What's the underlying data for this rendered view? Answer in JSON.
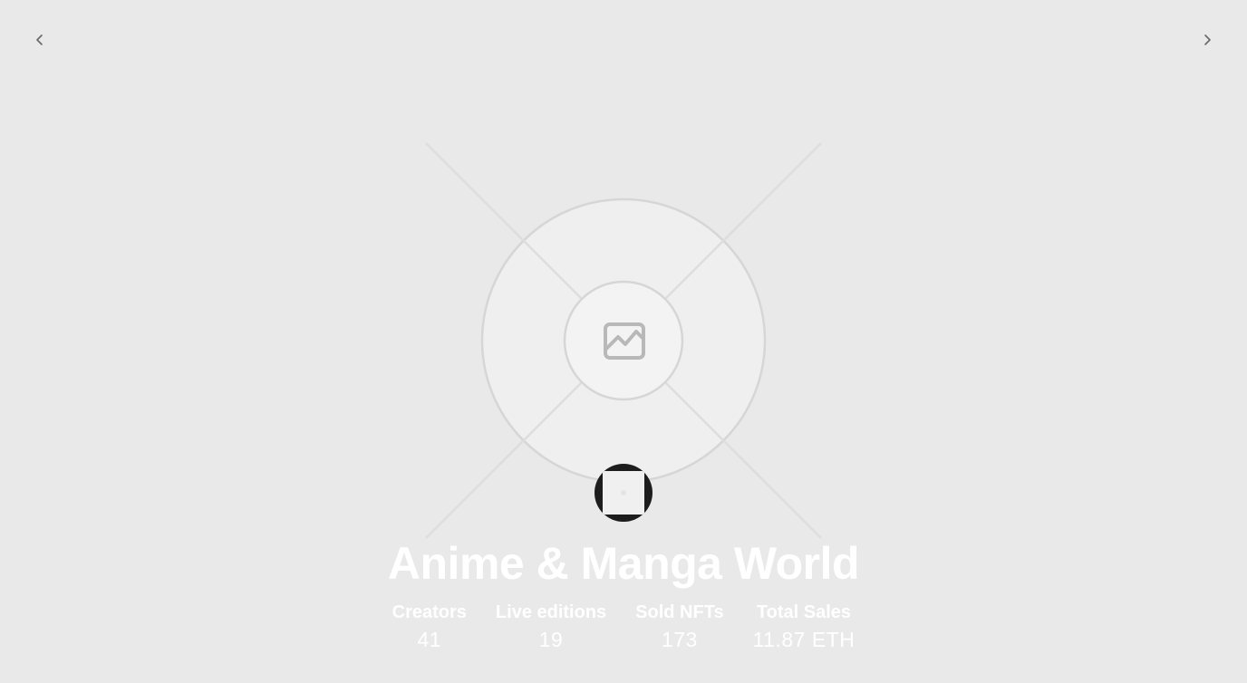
{
  "navigation": {
    "prev_icon": "chevron-left-icon",
    "next_icon": "chevron-right-icon"
  },
  "hero": {
    "placeholder_icon": "image-placeholder-icon"
  },
  "collection": {
    "title": "Anime & Manga World",
    "avatar_icon": "avatar"
  },
  "stats": [
    {
      "label": "Creators",
      "value": "41"
    },
    {
      "label": "Live editions",
      "value": "19"
    },
    {
      "label": "Sold NFTs",
      "value": "173"
    },
    {
      "label": "Total Sales",
      "value": "11.87 ETH"
    }
  ],
  "colors": {
    "background": "#e9e9e9",
    "text": "#ffffff",
    "avatar": "#1d1d1d",
    "placeholder_stroke": "#d6d6d6"
  }
}
